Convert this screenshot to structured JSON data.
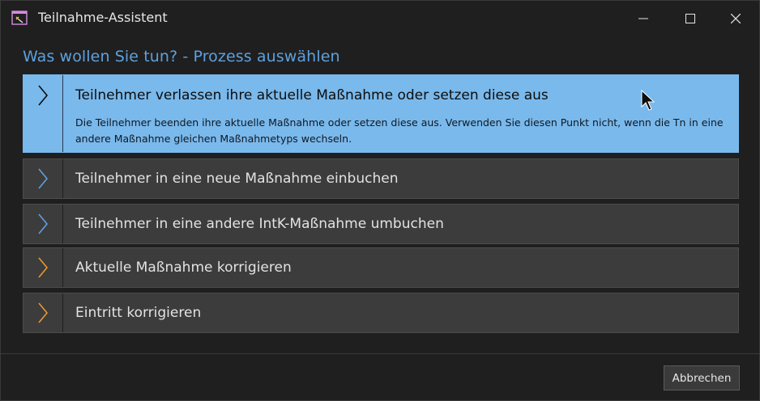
{
  "window": {
    "title": "Teilnahme-Assistent"
  },
  "heading": "Was wollen Sie tun? - Prozess auswählen",
  "options": [
    {
      "label": "Teilnehmer verlassen ihre aktuelle Maßnahme oder setzen diese aus",
      "description": "Die Teilnehmer beenden ihre aktuelle Maßnahme oder setzen diese aus. Verwenden Sie diesen Punkt nicht, wenn die Tn in eine andere Maßnahme gleichen Maßnahmetyps wechseln.",
      "icon": "chevron-right-icon",
      "chevron_color": "#0d0d0d",
      "selected": true
    },
    {
      "label": "Teilnehmer in eine neue Maßnahme einbuchen",
      "icon": "chevron-right-icon",
      "chevron_color": "#5ea0dd"
    },
    {
      "label": "Teilnehmer in eine andere IntK-Maßnahme umbuchen",
      "icon": "chevron-right-icon",
      "chevron_color": "#5ea0dd"
    },
    {
      "label": "Aktuelle Maßnahme korrigieren",
      "icon": "chevron-right-icon",
      "chevron_color": "#e8982a"
    },
    {
      "label": "Eintritt korrigieren",
      "icon": "chevron-right-icon",
      "chevron_color": "#e8982a"
    }
  ],
  "footer": {
    "cancel_label": "Abbrechen"
  },
  "colors": {
    "accent": "#5ea0dd",
    "selected_bg": "#7ab9ec",
    "item_bg": "#3c3c3c",
    "warning_chevron": "#e8982a"
  }
}
